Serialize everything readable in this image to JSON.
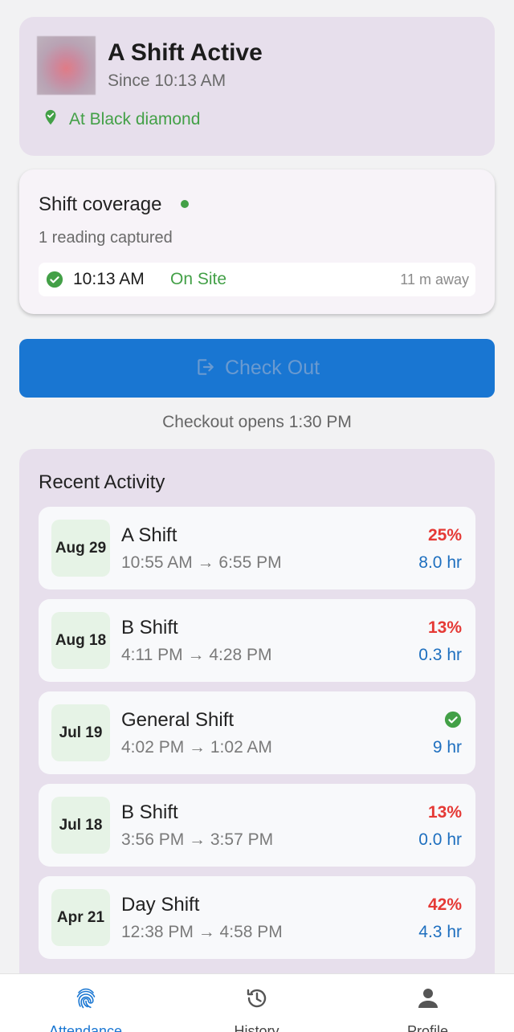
{
  "shift": {
    "title": "A Shift Active",
    "since": "Since 10:13 AM",
    "location": "At Black diamond",
    "avatar_alt": "profile photo"
  },
  "coverage": {
    "title": "Shift coverage",
    "subtitle": "1 reading captured",
    "reading": {
      "time": "10:13 AM",
      "status": "On Site",
      "distance": "11 m away"
    }
  },
  "checkout": {
    "button_label": "Check Out",
    "note": "Checkout opens 1:30 PM"
  },
  "recent": {
    "title": "Recent Activity",
    "items": [
      {
        "date": "Aug 29",
        "name": "A Shift",
        "time": "10:55 AM → 6:55 PM",
        "pct": "25%",
        "hours": "8.0 hr",
        "complete": false
      },
      {
        "date": "Aug 18",
        "name": "B Shift",
        "time": "4:11 PM → 4:28 PM",
        "pct": "13%",
        "hours": "0.3 hr",
        "complete": false
      },
      {
        "date": "Jul 19",
        "name": "General Shift",
        "time": "4:02 PM → 1:02 AM",
        "pct": "",
        "hours": "9 hr",
        "complete": true
      },
      {
        "date": "Jul 18",
        "name": "B Shift",
        "time": "3:56 PM → 3:57 PM",
        "pct": "13%",
        "hours": "0.0 hr",
        "complete": false
      },
      {
        "date": "Apr 21",
        "name": "Day Shift",
        "time": "12:38 PM → 4:58 PM",
        "pct": "42%",
        "hours": "4.3 hr",
        "complete": false
      }
    ]
  },
  "nav": {
    "items": [
      {
        "label": "Attendance",
        "icon": "fingerprint-icon",
        "active": true
      },
      {
        "label": "History",
        "icon": "history-icon",
        "active": false
      },
      {
        "label": "Profile",
        "icon": "person-icon",
        "active": false
      }
    ]
  },
  "colors": {
    "accent": "#1976d2",
    "success": "#43a047",
    "danger": "#e53935",
    "card_bg": "#e7dfec"
  }
}
